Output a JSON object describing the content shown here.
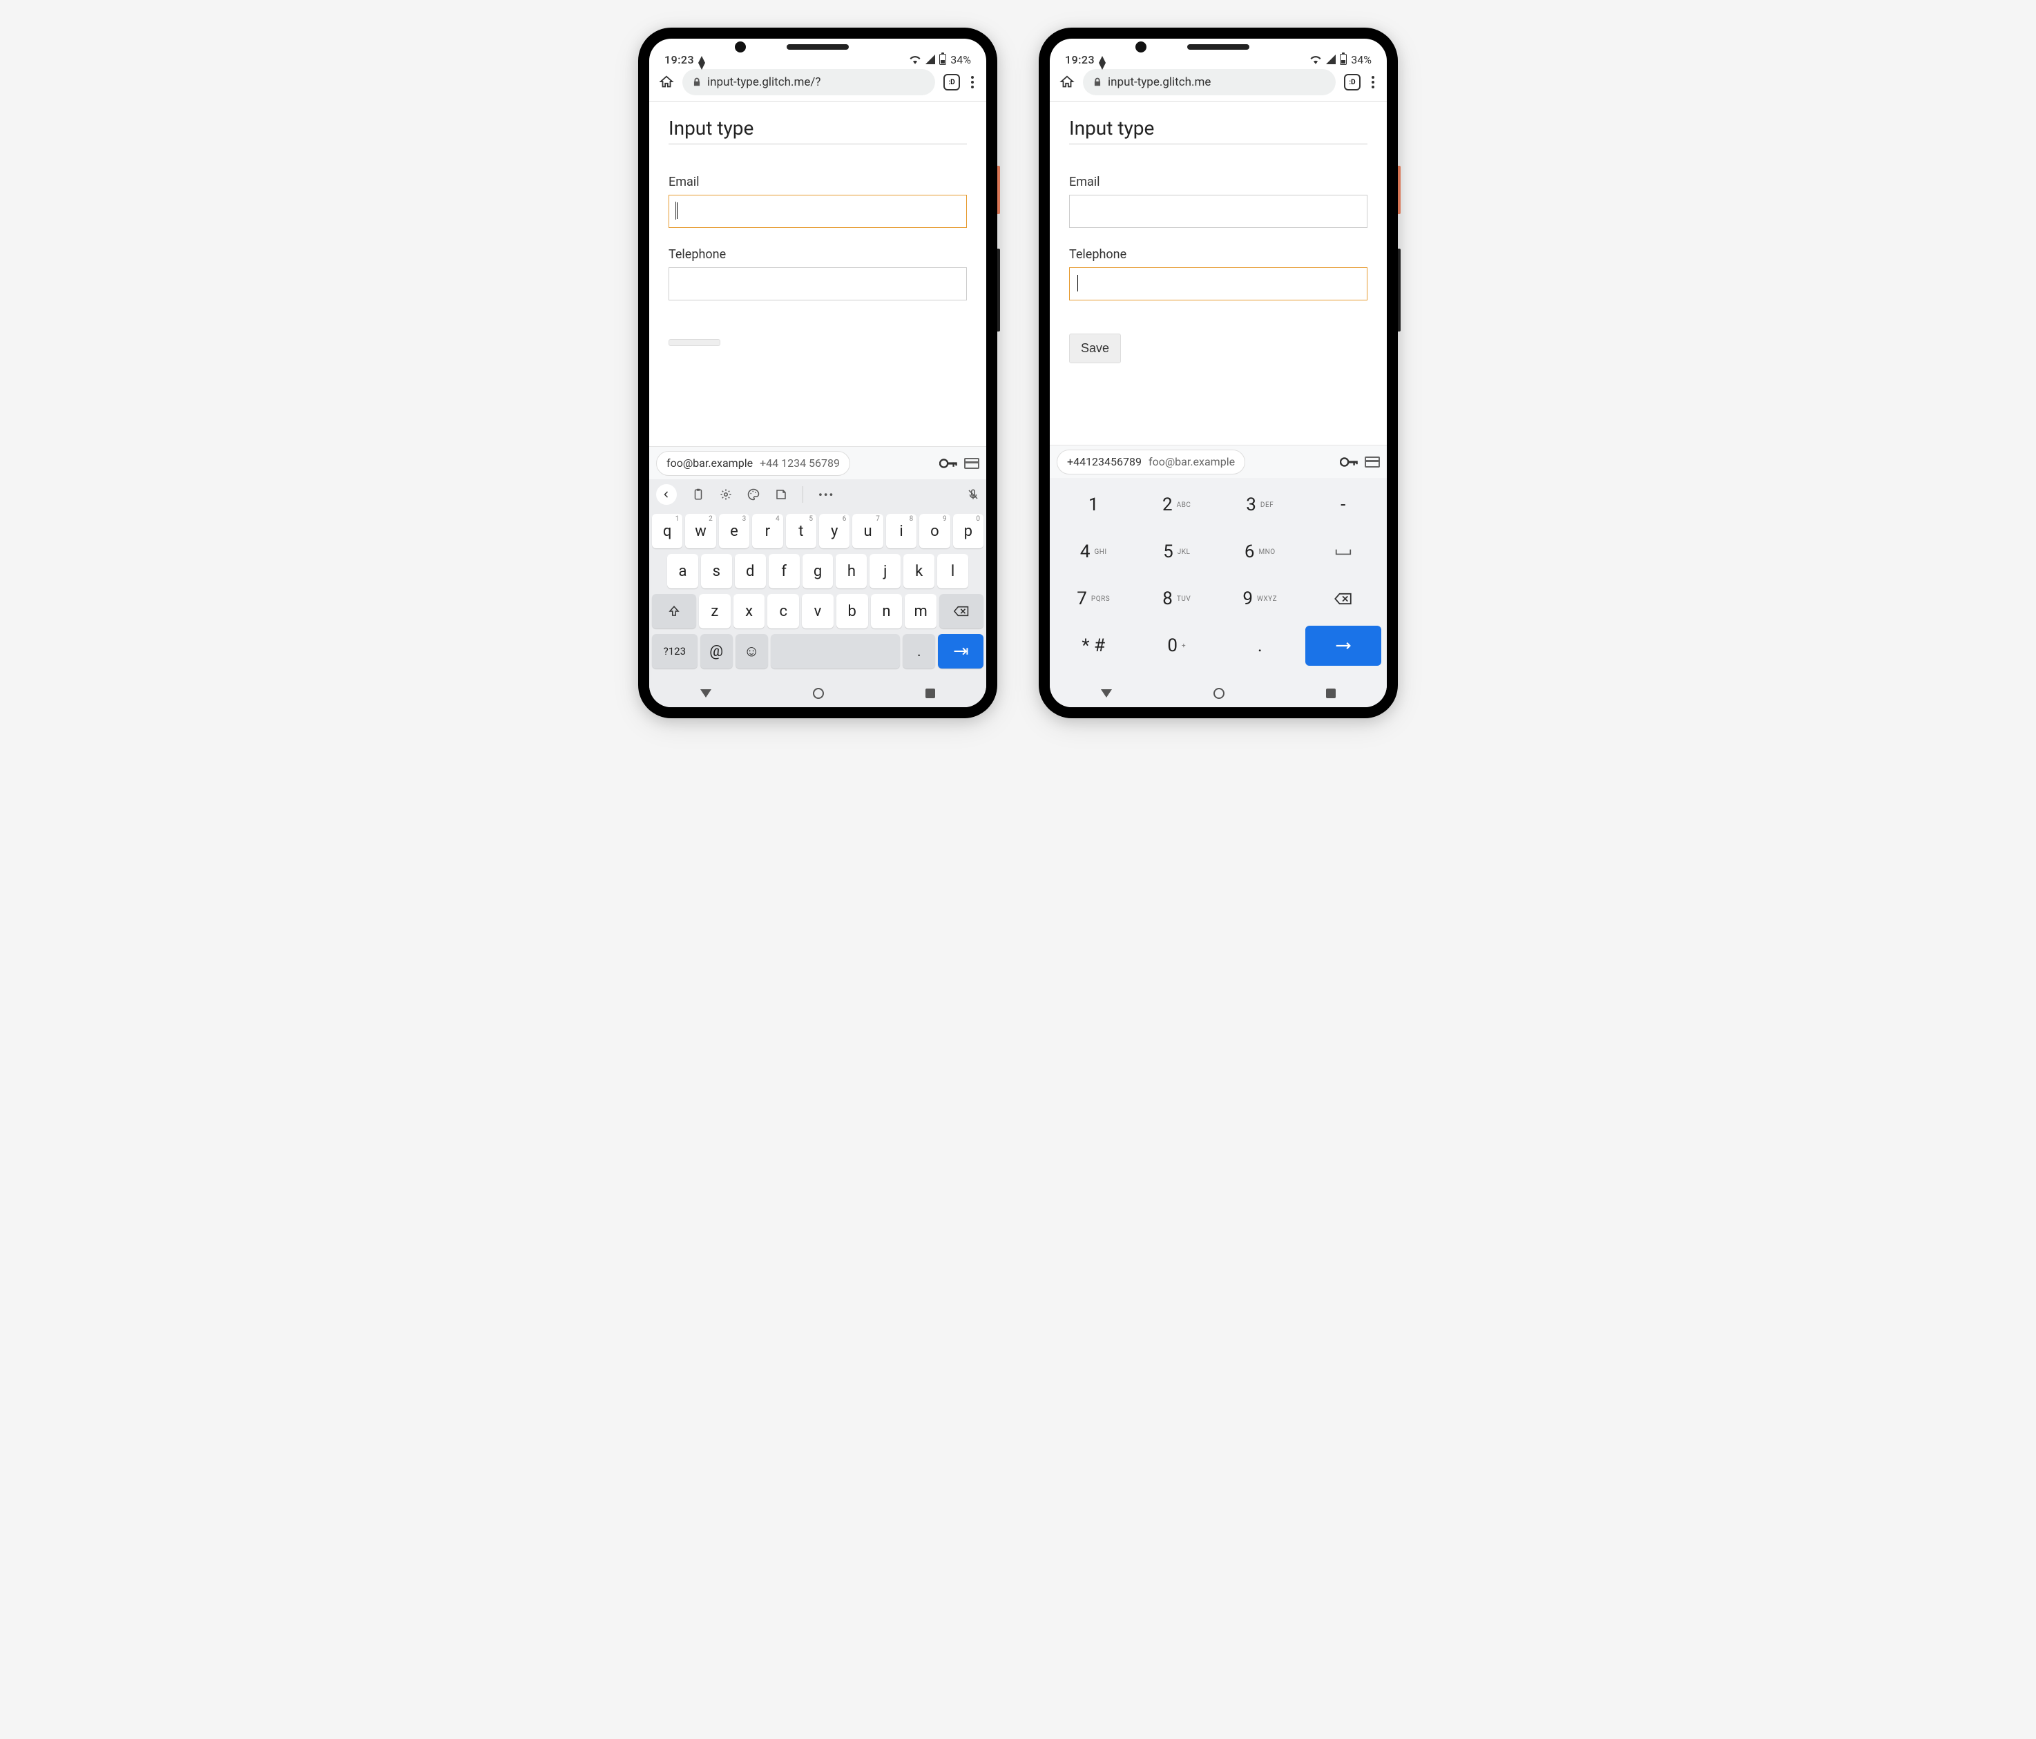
{
  "status": {
    "time": "19:23",
    "battery": "34%"
  },
  "browser": {
    "url_left": "input-type.glitch.me/?",
    "url_right": "input-type.glitch.me",
    "tab_badge": ":D"
  },
  "page": {
    "title": "Input type",
    "email_label": "Email",
    "tel_label": "Telephone",
    "save_label": "Save"
  },
  "suggestions": {
    "email": "foo@bar.example",
    "phone_spaced": "+44 1234 56789",
    "phone_compact": "+44123456789"
  },
  "qwerty": {
    "row1": [
      {
        "k": "q",
        "n": "1"
      },
      {
        "k": "w",
        "n": "2"
      },
      {
        "k": "e",
        "n": "3"
      },
      {
        "k": "r",
        "n": "4"
      },
      {
        "k": "t",
        "n": "5"
      },
      {
        "k": "y",
        "n": "6"
      },
      {
        "k": "u",
        "n": "7"
      },
      {
        "k": "i",
        "n": "8"
      },
      {
        "k": "o",
        "n": "9"
      },
      {
        "k": "p",
        "n": "0"
      }
    ],
    "row2": [
      "a",
      "s",
      "d",
      "f",
      "g",
      "h",
      "j",
      "k",
      "l"
    ],
    "row3": [
      "z",
      "x",
      "c",
      "v",
      "b",
      "n",
      "m"
    ],
    "sym_key": "?123",
    "at_key": "@",
    "period_key": "."
  },
  "numpad": {
    "rows": [
      [
        {
          "k": "1",
          "s": ""
        },
        {
          "k": "2",
          "s": "ABC"
        },
        {
          "k": "3",
          "s": "DEF"
        },
        {
          "k": "-",
          "s": ""
        }
      ],
      [
        {
          "k": "4",
          "s": "GHI"
        },
        {
          "k": "5",
          "s": "JKL"
        },
        {
          "k": "6",
          "s": "MNO"
        },
        {
          "k": "␣",
          "s": "",
          "icon": "space"
        }
      ],
      [
        {
          "k": "7",
          "s": "PQRS"
        },
        {
          "k": "8",
          "s": "TUV"
        },
        {
          "k": "9",
          "s": "WXYZ"
        },
        {
          "k": "⌫",
          "s": "",
          "icon": "del"
        }
      ],
      [
        {
          "k": "* #",
          "s": ""
        },
        {
          "k": "0",
          "s": "+"
        },
        {
          "k": ".",
          "s": ""
        },
        {
          "k": "→",
          "s": "",
          "icon": "enter"
        }
      ]
    ]
  }
}
